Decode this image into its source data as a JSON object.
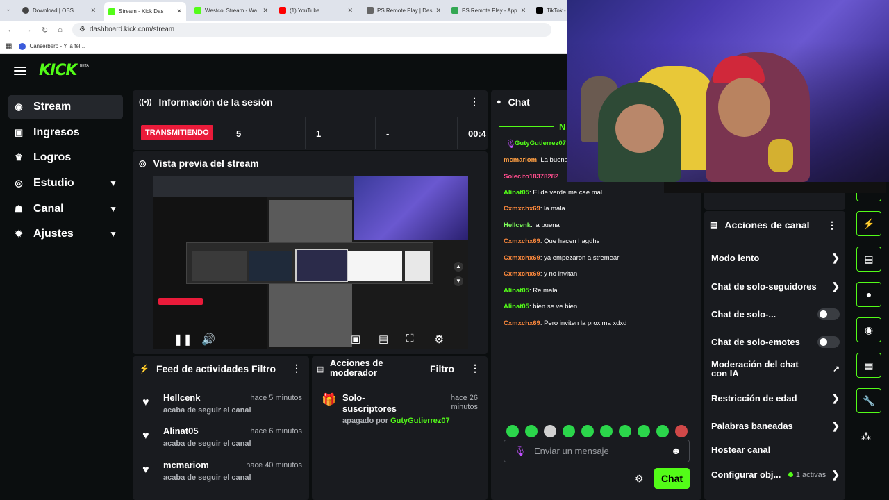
{
  "browser": {
    "tabs": [
      {
        "label": "Download | OBS",
        "color": "#444444"
      },
      {
        "label": "Stream - Kick Das",
        "color": "#53fc18"
      },
      {
        "label": "Westcol Stream - Wa",
        "color": "#53fc18"
      },
      {
        "label": "(1) YouTube",
        "color": "#ff0000"
      },
      {
        "label": "PS Remote Play | Des",
        "color": "#666666"
      },
      {
        "label": "PS Remote Play - App",
        "color": "#34a853"
      },
      {
        "label": "TikTok -",
        "color": "#000000"
      }
    ],
    "url": "dashboard.kick.com/stream",
    "bookmark": "Canserbero - Y la fel..."
  },
  "header": {
    "logo": "KICK",
    "badge": "BETA"
  },
  "sidebar": {
    "items": [
      {
        "label": "Stream",
        "icon": "broadcast-icon"
      },
      {
        "label": "Ingresos",
        "icon": "wallet-icon"
      },
      {
        "label": "Logros",
        "icon": "trophy-icon"
      },
      {
        "label": "Estudio",
        "icon": "camera-icon"
      },
      {
        "label": "Canal",
        "icon": "users-icon"
      },
      {
        "label": "Ajustes",
        "icon": "gear-icon"
      }
    ]
  },
  "session": {
    "title": "Información de la sesión",
    "status": "TRANSMITIENDO",
    "viewers": "5",
    "followers": "1",
    "subs": "-",
    "time": "00:4"
  },
  "preview": {
    "title": "Vista previa del stream"
  },
  "feed": {
    "title": "Feed de actividades",
    "filter": "Filtro",
    "items": [
      {
        "name": "Hellcenk",
        "time": "hace 5 minutos",
        "desc": "acaba de seguir el canal"
      },
      {
        "name": "Alinat05",
        "time": "hace 6 minutos",
        "desc": "acaba de seguir el canal"
      },
      {
        "name": "mcmariom",
        "time": "hace 40 minutos",
        "desc": "acaba de seguir el canal"
      }
    ]
  },
  "mod": {
    "title_line1": "Acciones de",
    "title_line2": "moderador",
    "filter": "Filtro",
    "item_title1": "Solo-",
    "item_title2": "suscriptores",
    "item_time1": "hace 26",
    "item_time2": "minutos",
    "item_desc": "apagado por",
    "item_user": "GutyGutierrez07"
  },
  "chat": {
    "title": "Chat",
    "partial_label": "N",
    "messages": [
      {
        "user": "GutyGutierrez07",
        "text": "",
        "color": "#53fc18"
      },
      {
        "user": "mcmariom",
        "text": "La buena",
        "color": "#ff9f43"
      },
      {
        "user": "Solecito18378282",
        "text": "",
        "color": "#ff4d8d"
      },
      {
        "user": "Alinat05",
        "text": "El de verde me cae mal",
        "color": "#53fc18"
      },
      {
        "user": "Cxmxchx69",
        "text": "la mala",
        "color": "#ff8a3d"
      },
      {
        "user": "Hellcenk",
        "text": "la buena",
        "color": "#7dff5a"
      },
      {
        "user": "Cxmxchx69",
        "text": "Que hacen hagdhs",
        "color": "#ff8a3d"
      },
      {
        "user": "Cxmxchx69",
        "text": "ya empezaron a stremear",
        "color": "#ff8a3d"
      },
      {
        "user": "Cxmxchx69",
        "text": "y no invitan",
        "color": "#ff8a3d"
      },
      {
        "user": "Alinat05",
        "text": "Re mala",
        "color": "#53fc18"
      },
      {
        "user": "Alinat05",
        "text": "bien se ve bien",
        "color": "#53fc18"
      },
      {
        "user": "Cxmxchx69",
        "text": "Pero inviten la proxima xdxd",
        "color": "#ff8a3d"
      }
    ],
    "placeholder": "Enviar un mensaje",
    "send": "Chat"
  },
  "channel": {
    "title": "Acciones de canal",
    "items": [
      {
        "label": "Modo lento",
        "kind": "arrow"
      },
      {
        "label": "Chat de solo-seguidores",
        "kind": "arrow"
      },
      {
        "label": "Chat de solo-...",
        "kind": "toggle"
      },
      {
        "label": "Chat de solo-emotes",
        "kind": "toggle"
      },
      {
        "label": "Moderación del chat con IA",
        "kind": "external"
      },
      {
        "label": "Restricción de edad",
        "kind": "arrow"
      },
      {
        "label": "Palabras baneadas",
        "kind": "arrow"
      },
      {
        "label": "Hostear canal",
        "kind": "none"
      },
      {
        "label": "Configurar obj...",
        "kind": "arrow",
        "extra": "1 activas"
      }
    ]
  },
  "colors": {
    "accent": "#53fc18",
    "live": "#ea1b3a",
    "panel": "#191b1f",
    "bg": "#0b0e0f"
  }
}
